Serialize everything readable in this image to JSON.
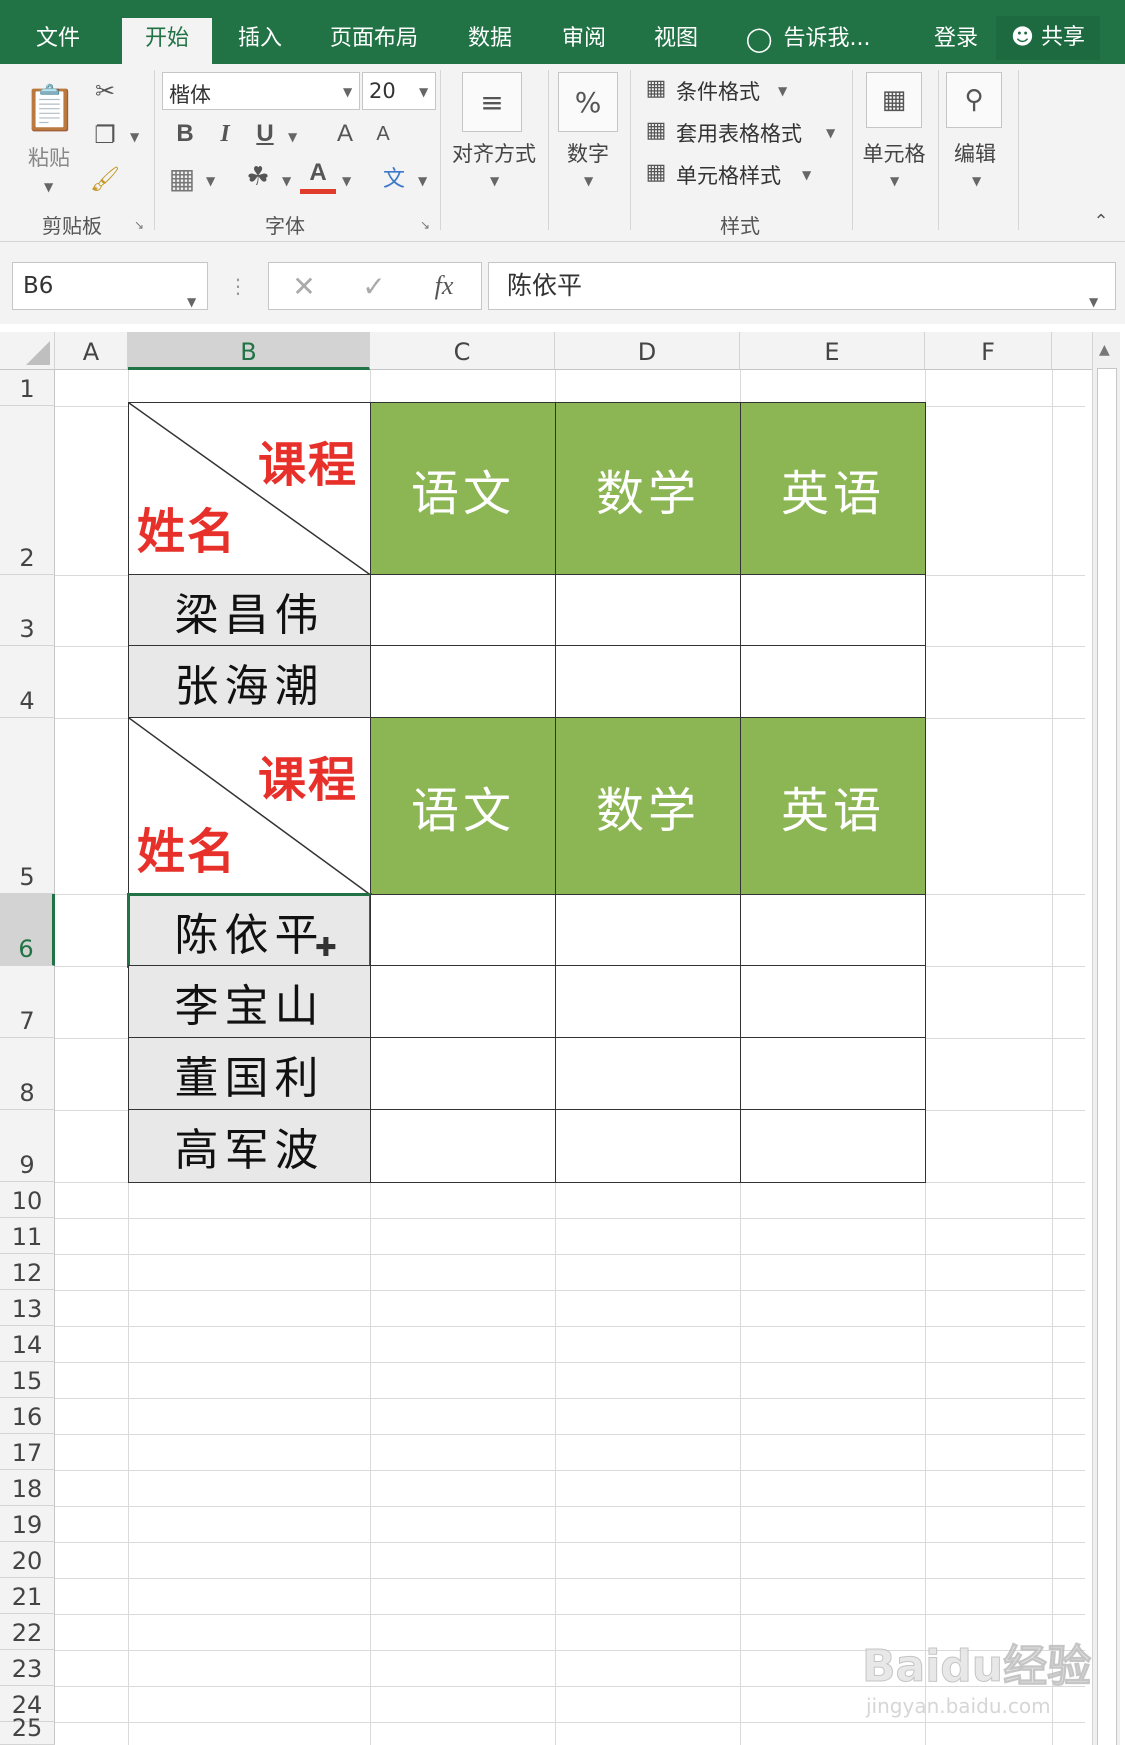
{
  "tabs": [
    {
      "label": "文件"
    },
    {
      "label": "开始"
    },
    {
      "label": "插入"
    },
    {
      "label": "页面布局"
    },
    {
      "label": "数据"
    },
    {
      "label": "审阅"
    },
    {
      "label": "视图"
    },
    {
      "label": "告诉我..."
    }
  ],
  "account": {
    "login": "登录",
    "share": "共享"
  },
  "ribbon": {
    "clipboard": {
      "paste": "粘贴",
      "label": "剪贴板"
    },
    "font": {
      "name": "楷体",
      "size": "20",
      "label": "字体",
      "bold": "B",
      "italic": "I",
      "underline": "U",
      "font_color": "A",
      "grow": "A",
      "shrink": "A",
      "phonetic": "文"
    },
    "align": {
      "label": "对齐方式"
    },
    "number": {
      "label": "数字",
      "symbol": "%"
    },
    "styles": {
      "conditional": "条件格式",
      "table": "套用表格格式",
      "cell_style": "单元格样式",
      "label": "样式"
    },
    "cells": {
      "label": "单元格"
    },
    "editing": {
      "label": "编辑"
    }
  },
  "formula_bar": {
    "name_box": "B6",
    "content": "陈依平",
    "fx": "fx"
  },
  "columns": [
    "A",
    "B",
    "C",
    "D",
    "E",
    "F"
  ],
  "rows": [
    "1",
    "2",
    "3",
    "4",
    "5",
    "6",
    "7",
    "8",
    "9",
    "10",
    "11",
    "12",
    "13",
    "14",
    "15",
    "16",
    "17",
    "18",
    "19",
    "20",
    "21",
    "22",
    "23",
    "24",
    "25"
  ],
  "table": {
    "corner_top": "课程",
    "corner_bottom": "姓名",
    "subjects": [
      "语文",
      "数学",
      "英语"
    ],
    "group1": [
      "梁昌伟",
      "张海潮"
    ],
    "group2": [
      "陈依平",
      "李宝山",
      "董国利",
      "高军波"
    ]
  },
  "watermark": {
    "logo": "Baidu经验",
    "url": "jingyan.baidu.com"
  },
  "colors": {
    "excel_green": "#217346",
    "header_fill": "#8cb653",
    "corner_text": "#e8302b",
    "name_fill": "#e8e8e8"
  }
}
